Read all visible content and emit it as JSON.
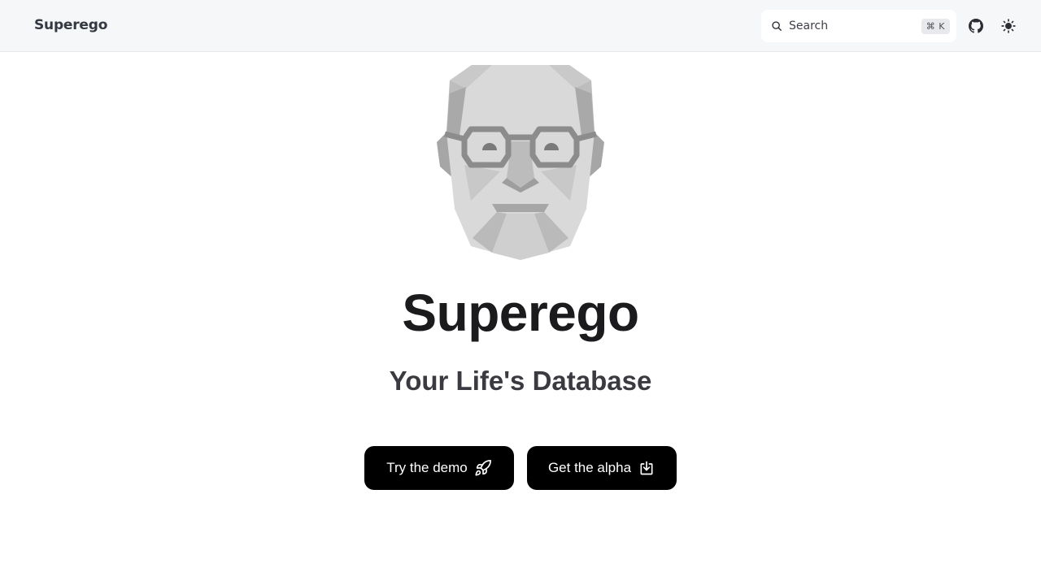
{
  "header": {
    "brand": "Superego",
    "search": {
      "label": "Search",
      "shortcut": "⌘ K",
      "icon": "search-icon"
    },
    "github_icon": "github-icon",
    "theme_icon": "sun-icon"
  },
  "hero": {
    "logo": "superego-face-logo",
    "title": "Superego",
    "subtitle": "Your Life's Database",
    "buttons": [
      {
        "label": "Try the demo",
        "icon": "rocket-icon"
      },
      {
        "label": "Get the alpha",
        "icon": "download-icon"
      }
    ]
  },
  "colors": {
    "nav_bg": "#f6f7f9",
    "button_bg": "#000000",
    "button_text": "#ffffff",
    "title_text": "#1b1b1d"
  }
}
